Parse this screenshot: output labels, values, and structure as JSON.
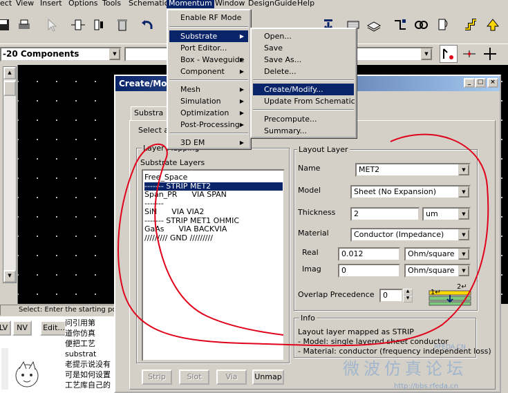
{
  "menubar": {
    "items": [
      "ect",
      "View",
      "Insert",
      "Options",
      "Tools",
      "Schematic",
      "Momentum",
      "Window",
      "DesignGuide",
      "Help"
    ]
  },
  "combos": {
    "components": "-20 Components",
    "second": ""
  },
  "status": {
    "text": "Select: Enter the starting poi"
  },
  "bottom_buttons": {
    "lv": "LV",
    "nv": "NV",
    "edit": "Edit..."
  },
  "chinese_lines": [
    "问引用第",
    "道你仿真",
    "便把工艺",
    "substrat",
    "老提示说没有",
    "可是如何设置",
    "工艺库自己的"
  ],
  "dialog": {
    "title": "Create/Modi",
    "tab": "Substra",
    "select_hint": "Select a",
    "layer_mapping_label": "Layer Mapping",
    "substrate_layers_label": "Substrate Layers",
    "layers": [
      "Free_Space",
      "------- STRIP MET2",
      "Span_PR      VIA SPAN",
      "-------",
      "SiN      VIA VIA2",
      "------- STRIP MET1 OHMIC",
      "GaAs      VIA BACKVIA",
      "///////// GND /////////"
    ],
    "selected_layer_index": 1,
    "buttons": {
      "strip": "Strip",
      "slot": "Slot",
      "via": "Via",
      "unmap": "Unmap"
    },
    "layout_layer": {
      "group_label": "Layout Layer",
      "name_label": "Name",
      "name_value": "MET2",
      "model_label": "Model",
      "model_value": "Sheet (No Expansion)",
      "thickness_label": "Thickness",
      "thickness_value": "2",
      "thickness_unit": "um",
      "material_label": "Material",
      "material_value": "Conductor (Impedance)",
      "real_label": "Real",
      "real_value": "0.012",
      "real_unit": "Ohm/square",
      "imag_label": "Imag",
      "imag_value": "0",
      "imag_unit": "Ohm/square",
      "overlap_label": "Overlap Precedence",
      "overlap_value": "0",
      "overlap_diagram_top": "2↵",
      "overlap_diagram_bottom": "1↵"
    },
    "info": {
      "group_label": "Info",
      "line1": "Layout layer mapped as STRIP",
      "line2": "- Model: single layered sheet conductor",
      "line3": "- Material: conductor (frequency independent loss)"
    }
  },
  "momentum_menu": {
    "items": [
      {
        "label": "Enable RF Mode",
        "submenu": false
      },
      {
        "label": "Substrate",
        "submenu": true
      },
      {
        "label": "Port Editor...",
        "submenu": false
      },
      {
        "label": "Box - Waveguide",
        "submenu": true
      },
      {
        "label": "Component",
        "submenu": true
      },
      {
        "label": "Mesh",
        "submenu": true
      },
      {
        "label": "Simulation",
        "submenu": true
      },
      {
        "label": "Optimization",
        "submenu": true
      },
      {
        "label": "Post-Processing",
        "submenu": true
      },
      {
        "label": "3D EM",
        "submenu": true
      }
    ]
  },
  "substrate_menu": {
    "items": [
      "Open...",
      "Save",
      "Save As...",
      "Delete...",
      "Create/Modify...",
      "Update From Schematic",
      "Precompute...",
      "Summary..."
    ]
  },
  "watermark": {
    "text": "微波仿真论坛",
    "url": "http://bbs.rfeda.cn",
    "logo": "RFEDA.CN"
  },
  "colors": {
    "accent": "#0a246a",
    "annotation": "#e0001a",
    "canvas": "#000000"
  }
}
